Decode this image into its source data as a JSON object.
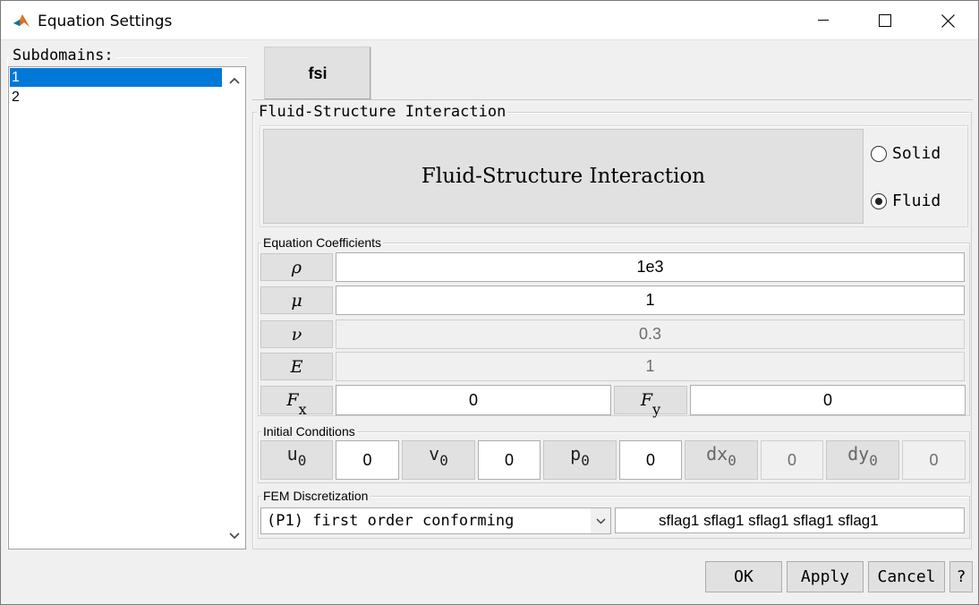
{
  "window": {
    "title": "Equation Settings"
  },
  "subdomains": {
    "label": "Subdomains:",
    "items": [
      "1",
      "2"
    ],
    "selected_index": 0
  },
  "mode_button": {
    "label": "fsi"
  },
  "panel": {
    "title": "Fluid-Structure Interaction",
    "header": "Fluid-Structure Interaction",
    "radio": {
      "solid_label": "Solid",
      "fluid_label": "Fluid",
      "selected": "Fluid"
    }
  },
  "coefficients": {
    "title": "Equation Coefficients",
    "rho": {
      "symbol": "ρ",
      "value": "1e3"
    },
    "mu": {
      "symbol": "μ",
      "value": "1"
    },
    "nu": {
      "symbol": "ν",
      "value": "0.3"
    },
    "E": {
      "symbol": "E",
      "value": "1"
    },
    "Fx": {
      "symbol": "F",
      "sub": "x",
      "value": "0"
    },
    "Fy": {
      "symbol": "F",
      "sub": "y",
      "value": "0"
    }
  },
  "initial": {
    "title": "Initial Conditions",
    "u0": {
      "symbol": "u",
      "sub": "0",
      "value": "0"
    },
    "v0": {
      "symbol": "v",
      "sub": "0",
      "value": "0"
    },
    "p0": {
      "symbol": "p",
      "sub": "0",
      "value": "0"
    },
    "dx0": {
      "symbol": "dx",
      "sub": "0",
      "value": "0"
    },
    "dy0": {
      "symbol": "dy",
      "sub": "0",
      "value": "0"
    }
  },
  "fem": {
    "title": "FEM Discretization",
    "selected": "(P1) first order conforming",
    "flags": "sflag1 sflag1 sflag1 sflag1 sflag1"
  },
  "footer": {
    "ok": "OK",
    "apply": "Apply",
    "cancel": "Cancel",
    "help": "?"
  },
  "colors": {
    "selection": "#0078d7",
    "background": "#f0f0f0"
  }
}
